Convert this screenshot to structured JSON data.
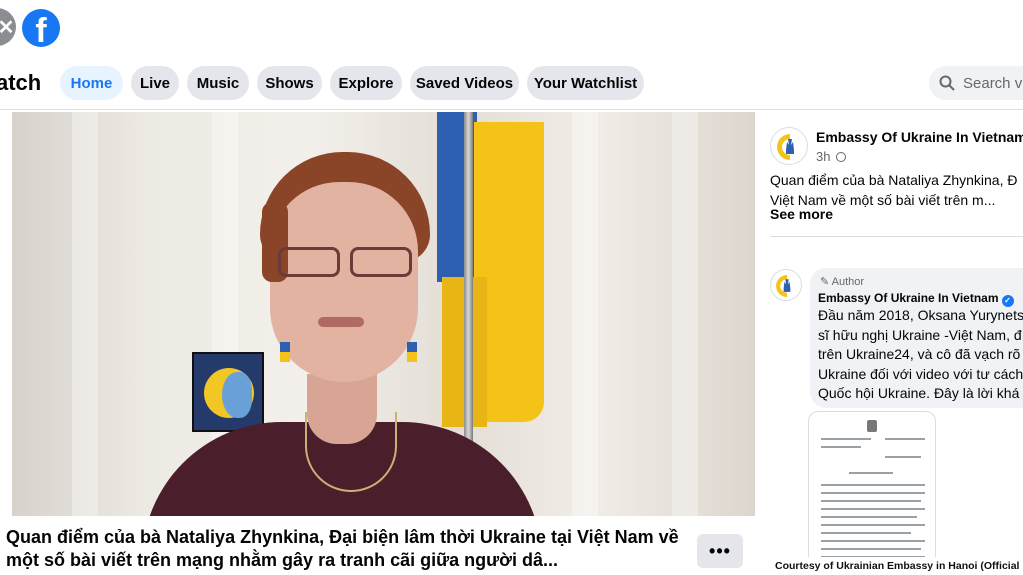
{
  "topbar": {
    "back_icon": "x-icon",
    "logo_letter": "f",
    "logo_color": "#1877f2"
  },
  "nav": {
    "title": "atch",
    "tabs": [
      {
        "label": "Home",
        "active": true
      },
      {
        "label": "Live"
      },
      {
        "label": "Music"
      },
      {
        "label": "Shows"
      },
      {
        "label": "Explore"
      },
      {
        "label": "Saved Videos"
      },
      {
        "label": "Your Watchlist"
      }
    ],
    "search_placeholder": "Search vid"
  },
  "video": {
    "title": "Quan điểm của bà Nataliya Zhynkina, Đại biện lâm thời Ukraine tại Việt Nam về một số bài viết trên mạng nhằm gây ra tranh cãi giữa người dâ...",
    "more_label": "•••"
  },
  "post": {
    "page_name": "Embassy Of Ukraine In Vietnam",
    "time": "3h",
    "text_line1": "Quan điểm của bà Nataliya Zhynkina, Đ",
    "text_line2": "Việt Nam về một số bài viết trên m...",
    "see_more": "See more"
  },
  "comment": {
    "author_badge": "Author",
    "name": "Embassy Of Ukraine In Vietnam",
    "lines": [
      "Đầu năm 2018, Oksana Yurynets",
      "sĩ hữu nghị Ukraine -Việt Nam, đ",
      "trên Ukraine24, và cô đã vạch rõ",
      "Ukraine đối với video với tư cách",
      "Quốc hội Ukraine. Đây là lời khá"
    ]
  },
  "credit": "Courtesy of Ukrainian Embassy in Hanoi (Official page)",
  "colors": {
    "accent": "#1877f2",
    "flag_blue": "#2f5fb0",
    "flag_yellow": "#f3c317"
  }
}
